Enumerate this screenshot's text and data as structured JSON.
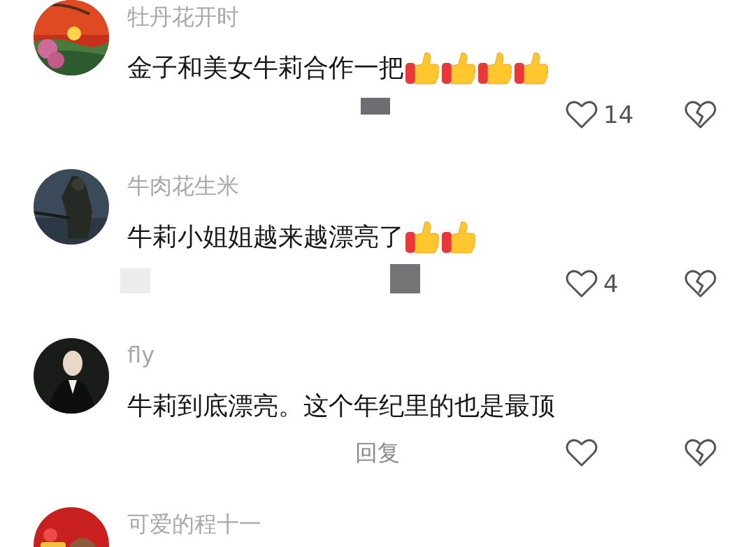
{
  "comments": [
    {
      "user": "牡丹花开时",
      "avatar": {
        "kind": "picture"
      },
      "text": "金子和美女牛莉合作一把",
      "emojis": [
        {
          "kind": "thumbs-up"
        },
        {
          "kind": "thumbs-up"
        },
        {
          "kind": "thumbs-up"
        },
        {
          "kind": "thumbs-up"
        }
      ],
      "masks": [
        {
          "color": "#6e6e72"
        }
      ],
      "likes": "14"
    },
    {
      "user": "牛肉花生米",
      "avatar": {
        "kind": "picture"
      },
      "text": "牛莉小姐姐越来越漂亮了",
      "emojis": [
        {
          "kind": "thumbs-up"
        },
        {
          "kind": "thumbs-up"
        }
      ],
      "masks": [
        {
          "color": "#ececee"
        },
        {
          "color": "#747476"
        }
      ],
      "likes": "4"
    },
    {
      "user": "fly",
      "avatar": {
        "kind": "picture"
      },
      "text": "牛莉到底漂亮。这个年纪里的也是最顶",
      "reply": "回复"
    },
    {
      "user": "可爱的程十一",
      "avatar": {
        "kind": "picture"
      }
    }
  ]
}
